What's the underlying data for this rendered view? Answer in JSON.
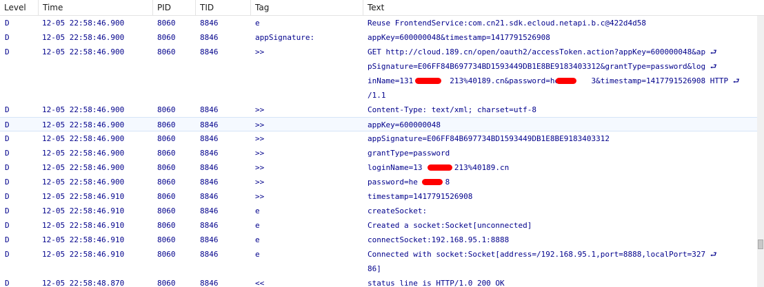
{
  "columns": [
    "Level",
    "Time",
    "PID",
    "TID",
    "Tag",
    "Text"
  ],
  "rows": [
    {
      "level": "D",
      "time": "12-05 22:58:46.900",
      "pid": "8060",
      "tid": "8846",
      "tag": "e",
      "text": [
        "Reuse FrontendService:com.cn21.sdk.ecloud.netapi.b.c@422d4d58"
      ]
    },
    {
      "level": "D",
      "time": "12-05 22:58:46.900",
      "pid": "8060",
      "tid": "8846",
      "tag": "appSignature:",
      "text": [
        "appKey=600000048&timestamp=1417791526908"
      ]
    },
    {
      "level": "D",
      "time": "12-05 22:58:46.900",
      "pid": "8060",
      "tid": "8846",
      "tag": ">>",
      "text": [
        "GET http://cloud.189.cn/open/oauth2/accessToken.action?appKey=600000048&ap ⮐",
        "pSignature=E06FF84B697734BD1593449DB1E8BE9183403312&grantType=password&log ⮐",
        "inName=131        213%40189.cn&password=he       3&timestamp=1417791526908 HTTP ⮐",
        "/1.1"
      ]
    },
    {
      "level": "D",
      "time": "12-05 22:58:46.900",
      "pid": "8060",
      "tid": "8846",
      "tag": ">>",
      "text": [
        "Content-Type: text/xml; charset=utf-8"
      ]
    },
    {
      "level": "D",
      "time": "12-05 22:58:46.900",
      "pid": "8060",
      "tid": "8846",
      "tag": ">>",
      "text": [
        "appKey=600000048"
      ]
    },
    {
      "level": "D",
      "time": "12-05 22:58:46.900",
      "pid": "8060",
      "tid": "8846",
      "tag": ">>",
      "text": [
        "appSignature=E06FF84B697734BD1593449DB1E8BE9183403312"
      ]
    },
    {
      "level": "D",
      "time": "12-05 22:58:46.900",
      "pid": "8060",
      "tid": "8846",
      "tag": ">>",
      "text": [
        "grantType=password"
      ]
    },
    {
      "level": "D",
      "time": "12-05 22:58:46.900",
      "pid": "8060",
      "tid": "8846",
      "tag": ">>",
      "text": [
        "loginName=13       213%40189.cn"
      ]
    },
    {
      "level": "D",
      "time": "12-05 22:58:46.900",
      "pid": "8060",
      "tid": "8846",
      "tag": ">>",
      "text": [
        "password=he      8"
      ]
    },
    {
      "level": "D",
      "time": "12-05 22:58:46.910",
      "pid": "8060",
      "tid": "8846",
      "tag": ">>",
      "text": [
        "timestamp=1417791526908"
      ]
    },
    {
      "level": "D",
      "time": "12-05 22:58:46.910",
      "pid": "8060",
      "tid": "8846",
      "tag": "e",
      "text": [
        "createSocket:"
      ]
    },
    {
      "level": "D",
      "time": "12-05 22:58:46.910",
      "pid": "8060",
      "tid": "8846",
      "tag": "e",
      "text": [
        "Created a socket:Socket[unconnected]"
      ]
    },
    {
      "level": "D",
      "time": "12-05 22:58:46.910",
      "pid": "8060",
      "tid": "8846",
      "tag": "e",
      "text": [
        "connectSocket:192.168.95.1:8888"
      ]
    },
    {
      "level": "D",
      "time": "12-05 22:58:46.910",
      "pid": "8060",
      "tid": "8846",
      "tag": "e",
      "text": [
        "Connected with socket:Socket[address=/192.168.95.1,port=8888,localPort=327 ⮐",
        "86]"
      ]
    },
    {
      "level": "D",
      "time": "12-05 22:58:48.870",
      "pid": "8060",
      "tid": "8846",
      "tag": "<<",
      "text": [
        "status line is HTTP/1.0 200 OK"
      ]
    }
  ],
  "selected_row": 4,
  "colors": {
    "text": "#00008b",
    "selection_bg": "#f5f9ff",
    "redaction": "#ff0000"
  }
}
